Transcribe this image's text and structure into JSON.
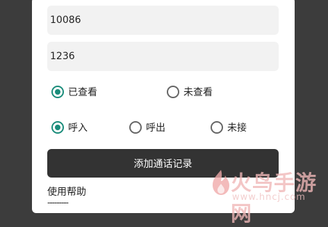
{
  "inputs": {
    "phone_value": "10086",
    "duration_value": "1236"
  },
  "read_status": {
    "options": [
      {
        "label": "已查看",
        "selected": true
      },
      {
        "label": "未查看",
        "selected": false
      }
    ]
  },
  "call_type": {
    "options": [
      {
        "label": "呼入",
        "selected": true
      },
      {
        "label": "呼出",
        "selected": false
      },
      {
        "label": "未接",
        "selected": false
      }
    ]
  },
  "add_button_label": "添加通话记录",
  "help": {
    "title": "使用帮助",
    "divider": "---------"
  },
  "watermark": {
    "brand": "火鸟手游网",
    "url": "www.hncj.com"
  },
  "colors": {
    "accent": "#1a8c7a",
    "button_bg": "#333333"
  }
}
